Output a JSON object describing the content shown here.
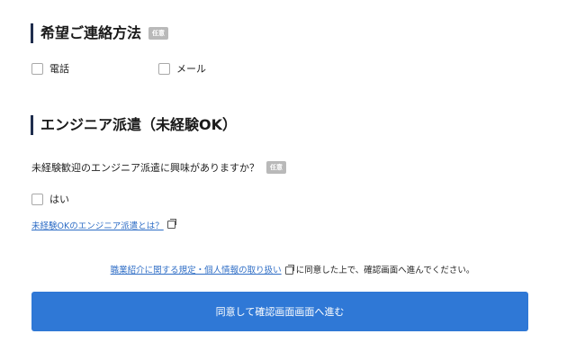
{
  "contact_section": {
    "title": "希望ご連絡方法",
    "badge": "任意",
    "options": [
      {
        "label": "電話",
        "checked": false
      },
      {
        "label": "メール",
        "checked": false
      }
    ]
  },
  "engineer_section": {
    "title": "エンジニア派遣（未経験OK）",
    "question": "未経験歓迎のエンジニア派遣に興味がありますか？",
    "badge": "任意",
    "option_label": "はい",
    "info_link": "未経験OKのエンジニア派遣とは？"
  },
  "consent": {
    "link_text": "職業紹介に関する規定・個人情報の取り扱い",
    "text": "に同意した上で、確認画面へ進んでください。"
  },
  "submit": {
    "label": "同意して確認画面画面へ進む"
  }
}
